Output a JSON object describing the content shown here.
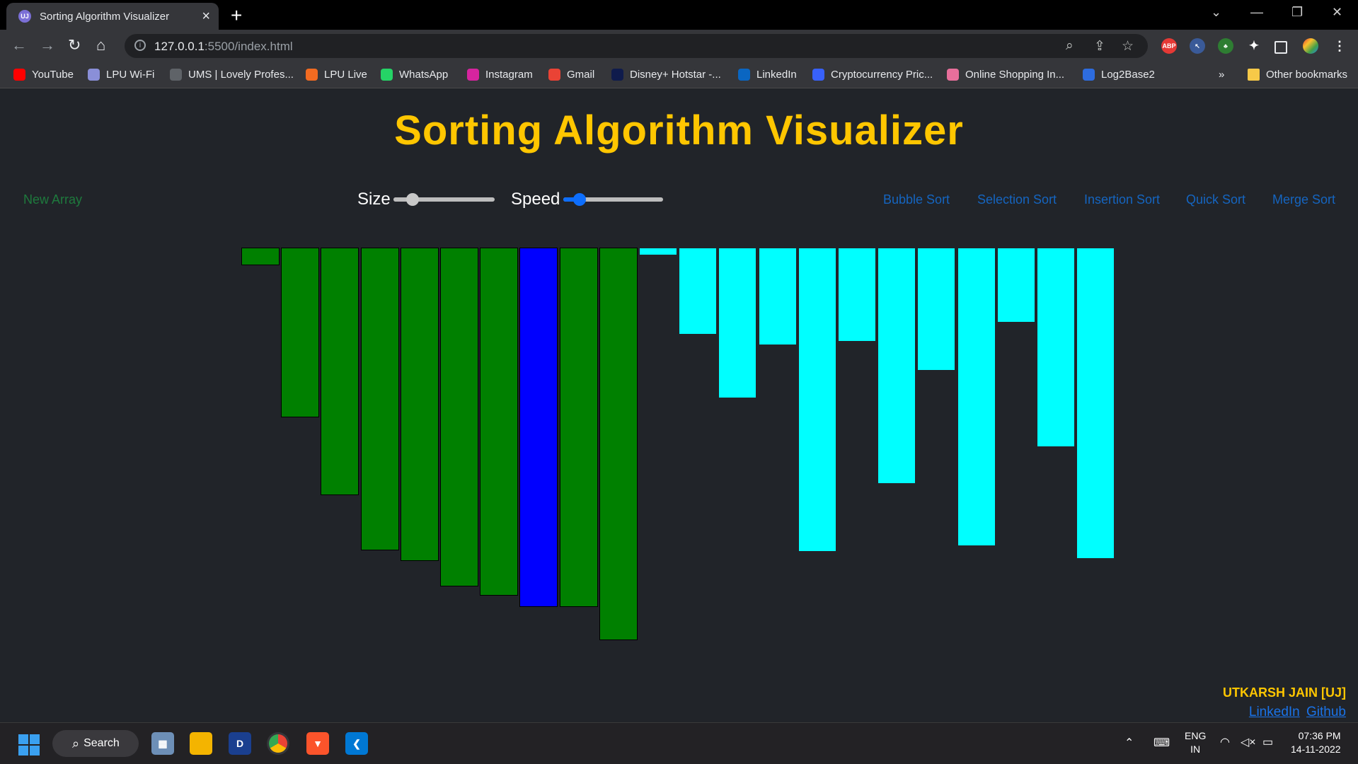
{
  "browser": {
    "tab_title": "Sorting Algorithm Visualizer",
    "url_host": "127.0.0.1",
    "url_path": ":5500/index.html",
    "other_bookmarks": "Other bookmarks",
    "bookmarks": [
      {
        "label": "YouTube",
        "icon": "youtube-icon",
        "color": "#ff0000"
      },
      {
        "label": "LPU Wi-Fi",
        "icon": "wifi-cloud-icon",
        "color": "#8a8fd8"
      },
      {
        "label": "UMS | Lovely Profes...",
        "icon": "globe-icon",
        "color": "#5f6368"
      },
      {
        "label": "LPU Live",
        "icon": "lpu-live-icon",
        "color": "#f26b21"
      },
      {
        "label": "WhatsApp",
        "icon": "whatsapp-icon",
        "color": "#25d366"
      },
      {
        "label": "Instagram",
        "icon": "instagram-icon",
        "color": "#d6249f"
      },
      {
        "label": "Gmail",
        "icon": "gmail-icon",
        "color": "#ea4335"
      },
      {
        "label": "Disney+ Hotstar -...",
        "icon": "hotstar-icon",
        "color": "#0f1b4c"
      },
      {
        "label": "LinkedIn",
        "icon": "linkedin-icon",
        "color": "#0a66c2"
      },
      {
        "label": "Cryptocurrency Pric...",
        "icon": "crypto-icon",
        "color": "#3861fb"
      },
      {
        "label": "Online Shopping In...",
        "icon": "shopping-icon",
        "color": "#e86f9b"
      },
      {
        "label": "Log2Base2",
        "icon": "log2base2-icon",
        "color": "#2d6cdf"
      }
    ]
  },
  "app": {
    "title": "Sorting Algorithm Visualizer",
    "new_array": "New Array",
    "size_label": "Size",
    "speed_label": "Speed",
    "size_value": 0.19,
    "speed_value": 0.16,
    "algorithms": [
      "Bubble Sort",
      "Selection Sort",
      "Insertion Sort",
      "Quick Sort",
      "Merge Sort"
    ],
    "colors": {
      "title": "#ffc600",
      "sorted": "#008000",
      "current": "#0000ff",
      "unsorted": "#00ffff",
      "new_array": "#1e7a3d",
      "algo_link": "#1565c0"
    },
    "bars": [
      {
        "value": 25,
        "state": "sorted"
      },
      {
        "value": 240,
        "state": "sorted"
      },
      {
        "value": 350,
        "state": "sorted"
      },
      {
        "value": 428,
        "state": "sorted"
      },
      {
        "value": 443,
        "state": "sorted"
      },
      {
        "value": 479,
        "state": "sorted"
      },
      {
        "value": 492,
        "state": "sorted"
      },
      {
        "value": 508,
        "state": "current"
      },
      {
        "value": 508,
        "state": "sorted"
      },
      {
        "value": 555,
        "state": "sorted"
      },
      {
        "value": 11,
        "state": "unsorted"
      },
      {
        "value": 123,
        "state": "unsorted"
      },
      {
        "value": 213,
        "state": "unsorted"
      },
      {
        "value": 138,
        "state": "unsorted"
      },
      {
        "value": 430,
        "state": "unsorted"
      },
      {
        "value": 133,
        "state": "unsorted"
      },
      {
        "value": 334,
        "state": "unsorted"
      },
      {
        "value": 174,
        "state": "unsorted"
      },
      {
        "value": 422,
        "state": "unsorted"
      },
      {
        "value": 106,
        "state": "unsorted"
      },
      {
        "value": 282,
        "state": "unsorted"
      },
      {
        "value": 440,
        "state": "unsorted"
      }
    ],
    "author": {
      "name": "UTKARSH JAIN [UJ]",
      "linkedin": "LinkedIn",
      "github": "Github"
    }
  },
  "taskbar": {
    "search": "Search",
    "lang_top": "ENG",
    "lang_bottom": "IN",
    "time": "07:36 PM",
    "date": "14-11-2022"
  }
}
